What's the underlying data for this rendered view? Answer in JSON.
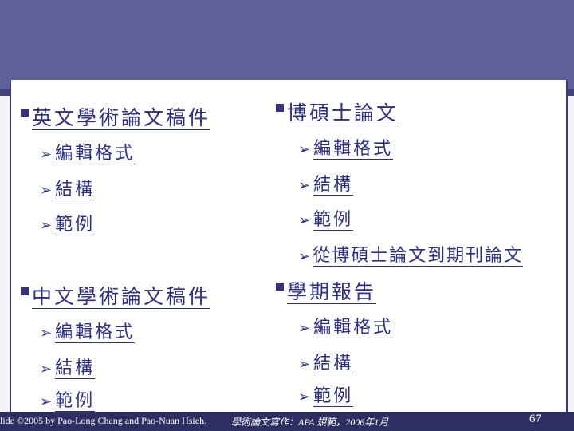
{
  "left_top": {
    "heading": "英文學術論文稿件",
    "items": [
      "編輯格式",
      "結構",
      "範例"
    ]
  },
  "right_top": {
    "heading": "博碩士論文",
    "items": [
      "編輯格式",
      "結構",
      "範例",
      "從博碩士論文到期刊論文"
    ]
  },
  "left_bottom": {
    "heading": "中文學術論文稿件",
    "items": [
      "編輯格式",
      "結構",
      "範例"
    ]
  },
  "right_bottom": {
    "heading": "學期報告",
    "items": [
      "編輯格式",
      "結構",
      "範例"
    ]
  },
  "footer": {
    "credit": "lide ©2005 by Pao-Long Chang and Pao-Nuan Hsieh.",
    "course": "學術論文寫作：APA 規範，2006年1月",
    "page": "67"
  },
  "colors": {
    "band": "#5f5f9a",
    "text": "#2d2d8c",
    "footer": "#2e2e62"
  }
}
